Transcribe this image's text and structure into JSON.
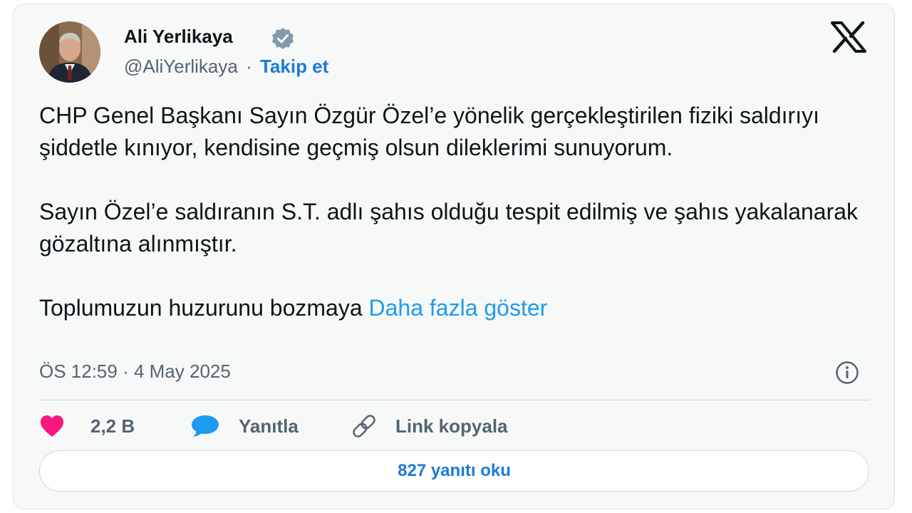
{
  "author": {
    "name": "Ali Yerlikaya",
    "handle": "@AliYerlikaya",
    "separator": "·",
    "follow_label": "Takip et"
  },
  "tweet": {
    "paragraphs": [
      "CHP Genel Başkanı Sayın Özgür Özel’e yönelik gerçekleştirilen fiziki saldırıyı şiddetle kınıyor, kendisine geçmiş olsun dileklerimi sunuyorum.",
      "Sayın Özel’e saldıranın S.T. adlı şahıs olduğu tespit edilmiş ve şahıs yakalanarak gözaltına alınmıştır."
    ],
    "truncated_text": "Toplumuzun huzurunu bozmaya",
    "show_more_label": "Daha fazla göster",
    "timestamp": "ÖS 12:59 · 4 May 2025"
  },
  "actions": {
    "like_count": "2,2 B",
    "reply_label": "Yanıtla",
    "copy_link_label": "Link kopyala"
  },
  "read_replies_label": "827 yanıtı oku",
  "colors": {
    "accent": "#1d9bf0",
    "follow": "#1d7bd8",
    "like": "#f91880",
    "reply": "#1d9bf0",
    "text": "#0f1419",
    "muted": "#536471"
  },
  "icons": {
    "verified": "verified-badge-icon",
    "brand": "x-logo-icon",
    "info": "info-icon",
    "like": "heart-icon",
    "reply": "speech-bubble-icon",
    "link": "link-icon"
  }
}
